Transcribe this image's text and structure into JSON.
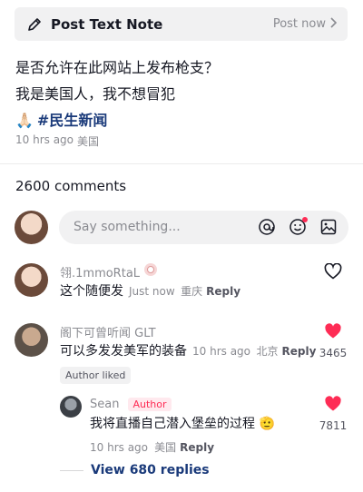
{
  "note_bar": {
    "title": "Post Text Note",
    "action": "Post now",
    "pencil_icon": "pencil-icon",
    "chevron_icon": "chevron-right-icon"
  },
  "post": {
    "line1": "是否允许在此网站上发布枪支？",
    "line2": "我是美国人，我不想冒犯",
    "emoji": "🙏🏻",
    "hashtag": "#民生新闻",
    "time": "10 hrs ago",
    "location": "美国"
  },
  "comments_header": {
    "count_label": "2600 comments"
  },
  "composer": {
    "placeholder": "Say something...",
    "icons": [
      "at-icon",
      "emoji-icon",
      "image-icon"
    ]
  },
  "comments": [
    {
      "username": "翎.1mmoRtaL",
      "text": "这个随便发",
      "time": "Just now",
      "location": "重庆",
      "reply_label": "Reply",
      "liked": false,
      "likes": ""
    },
    {
      "username": "阁下可曾听闻 GLT",
      "text": "可以多发发美军的装备",
      "time": "10 hrs ago",
      "location": "北京",
      "reply_label": "Reply",
      "liked": true,
      "likes": "3465",
      "chip": "Author liked"
    }
  ],
  "reply": {
    "username": "Sean",
    "author_tag": "Author",
    "text": "我将直播自己潜入堡垒的过程",
    "emoji": "🫡",
    "time": "10 hrs ago",
    "location": "美国",
    "reply_label": "Reply",
    "liked": true,
    "likes": "7811"
  },
  "view_replies": {
    "label": "View 680 replies"
  },
  "colors": {
    "accent_red": "#fe2c55",
    "link_blue": "#1a3a7a",
    "muted": "#8a8b91",
    "text": "#161823"
  }
}
